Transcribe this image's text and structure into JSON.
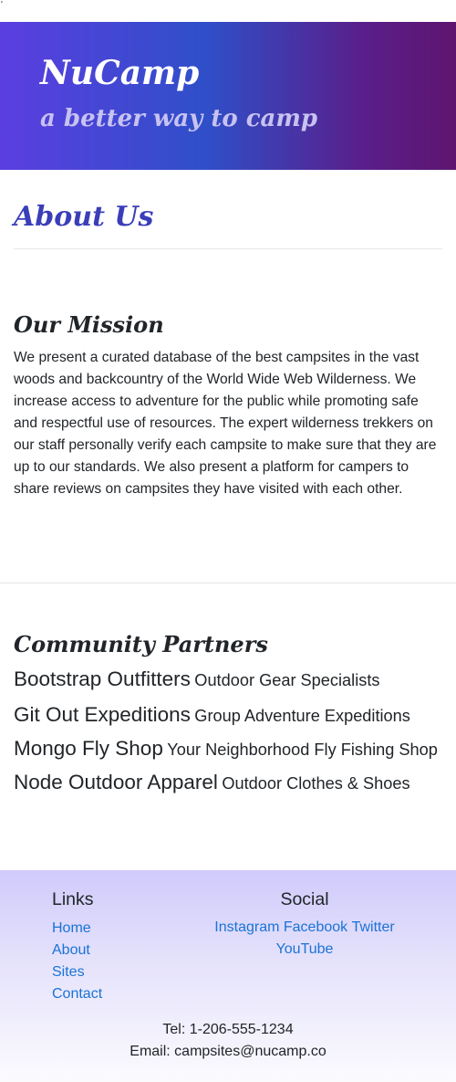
{
  "stray_mark": "'",
  "header": {
    "brand": "NuCamp",
    "tagline": "a better way to camp"
  },
  "page": {
    "title": "About Us"
  },
  "mission": {
    "heading": "Our Mission",
    "text": "We present a curated database of the best campsites in the vast woods and backcountry of the World Wide Web Wilderness. We increase access to adventure for the public while promoting safe and respectful use of resources. The expert wilderness trekkers on our staff personally verify each campsite to make sure that they are up to our standards. We also present a platform for campers to share reviews on campsites they have visited with each other."
  },
  "partners": {
    "heading": "Community Partners",
    "items": [
      {
        "name": "Bootstrap Outfitters",
        "description": "Outdoor Gear Specialists"
      },
      {
        "name": "Git Out Expeditions",
        "description": "Group Adventure Expeditions"
      },
      {
        "name": "Mongo Fly Shop",
        "description": "Your Neighborhood Fly Fishing Shop"
      },
      {
        "name": "Node Outdoor Apparel",
        "description": "Outdoor Clothes & Shoes"
      }
    ]
  },
  "footer": {
    "links_heading": "Links",
    "links": [
      "Home",
      "About",
      "Sites",
      "Contact"
    ],
    "social_heading": "Social",
    "social": [
      "Instagram",
      "Facebook",
      "Twitter",
      "YouTube"
    ],
    "phone": "Tel: 1-206-555-1234",
    "email": "Email: campsites@nucamp.co"
  },
  "colors": {
    "header_gradient_start": "#5b3ee0",
    "header_gradient_end": "#5e1570",
    "title_accent": "#3a3eb8",
    "link": "#1a73d6",
    "footer_top": "#d0cbfb"
  }
}
